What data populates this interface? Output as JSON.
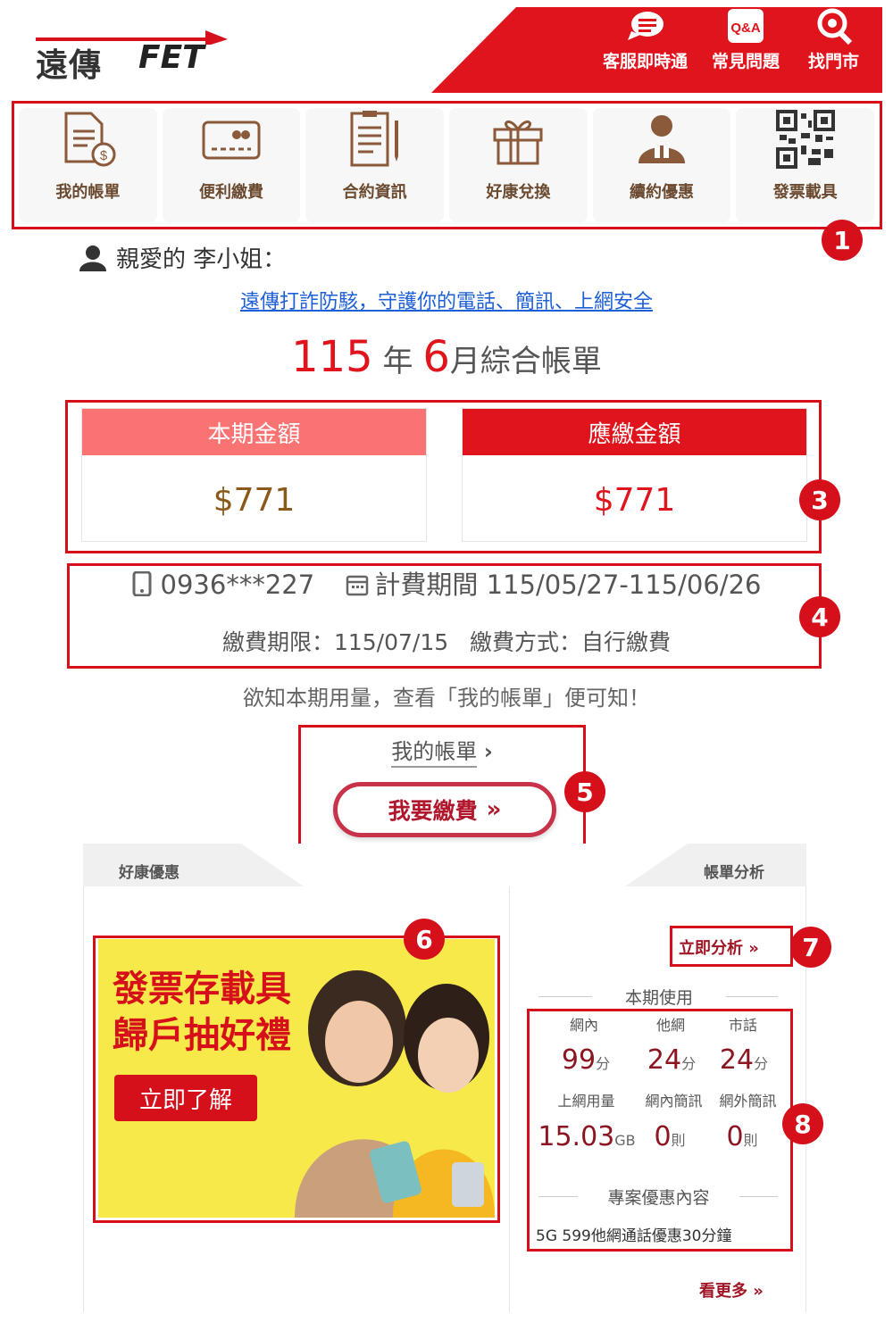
{
  "header": {
    "logo_text": "遠傳",
    "logo_brand": "FET",
    "items": [
      {
        "label": "客服即時通",
        "icon": "chat-icon"
      },
      {
        "label": "常見問題",
        "icon": "qa-icon"
      },
      {
        "label": "找門市",
        "icon": "location-icon"
      }
    ]
  },
  "nav": {
    "items": [
      {
        "label": "我的帳單",
        "icon": "bill-document-icon"
      },
      {
        "label": "便利繳費",
        "icon": "card-icon"
      },
      {
        "label": "合約資訊",
        "icon": "contract-icon"
      },
      {
        "label": "好康兌換",
        "icon": "gift-icon"
      },
      {
        "label": "續約優惠",
        "icon": "renew-person-icon"
      },
      {
        "label": "發票載具",
        "icon": "qr-code-icon"
      }
    ]
  },
  "greeting": "親愛的 李小姐：",
  "anti_fraud_link": "遠傳打詐防駭，守護你的電話、簡訊、上網安全",
  "bill_title": {
    "year": "115",
    "year_unit": "年",
    "month": "6",
    "suffix": "月綜合帳單"
  },
  "amounts": {
    "current": {
      "label": "本期金額",
      "value": "$771"
    },
    "due": {
      "label": "應繳金額",
      "value": "$771"
    }
  },
  "account": {
    "phone": "0936***227",
    "period_label": "計費期間",
    "period": "115/05/27-115/06/26",
    "deadline_label": "繳費期限：",
    "deadline": "115/07/15",
    "method_label": "繳費方式：",
    "method": "自行繳費"
  },
  "usage_hint": "欲知本期用量，查看「我的帳單」便可知！",
  "my_bill_link": "我的帳單",
  "pay_button": "我要繳費",
  "tabs": {
    "left": "好康優惠",
    "right": "帳單分析"
  },
  "promo": {
    "line1": "發票存載具",
    "line2": "歸戶抽好禮",
    "button": "立即了解"
  },
  "analysis": {
    "analyze_link": "立即分析",
    "usage_title": "本期使用",
    "calls": [
      {
        "label": "網內",
        "value": "99",
        "unit": "分"
      },
      {
        "label": "他網",
        "value": "24",
        "unit": "分"
      },
      {
        "label": "市話",
        "value": "24",
        "unit": "分"
      }
    ],
    "data_items": [
      {
        "label": "上網用量",
        "value": "15.03",
        "unit": "GB"
      },
      {
        "label": "網內簡訊",
        "value": "0",
        "unit": "則"
      },
      {
        "label": "網外簡訊",
        "value": "0",
        "unit": "則"
      }
    ],
    "plan_title": "專案優惠內容",
    "plan_text": "5G 599他網通話優惠30分鐘",
    "see_more": "看更多"
  },
  "markers": [
    "1",
    "3",
    "4",
    "5",
    "6",
    "7",
    "8"
  ],
  "colors": {
    "brand_red": "#e0141c",
    "light_red": "#f97373",
    "text_brown": "#6b4a30"
  }
}
